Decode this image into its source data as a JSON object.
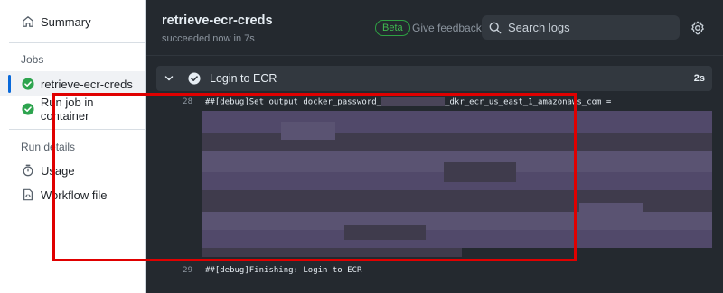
{
  "sidebar": {
    "summary_label": "Summary",
    "jobs_heading": "Jobs",
    "jobs": [
      {
        "label": "retrieve-ecr-creds",
        "active": true
      },
      {
        "label": "Run job in container",
        "active": false
      }
    ],
    "run_details_heading": "Run details",
    "details": [
      {
        "label": "Usage"
      },
      {
        "label": "Workflow file"
      }
    ]
  },
  "header": {
    "job_title": "retrieve-ecr-creds",
    "job_status": "succeeded now in 7s",
    "beta_badge": "Beta",
    "feedback_link": "Give feedback",
    "search_placeholder": "Search logs"
  },
  "step": {
    "label": "Login to ECR",
    "duration": "2s"
  },
  "log": {
    "line28_no": "28",
    "line28_text_pre": "##[debug]Set output docker_password_",
    "line28_text_post": "_dkr_ecr_us_east_1_amazonaws_com =",
    "line29_no": "29",
    "line29_text": "##[debug]Finishing: Login to ECR"
  },
  "colors": {
    "success": "#2da44e",
    "accent": "#0969da",
    "highlight_border": "#e00000"
  }
}
